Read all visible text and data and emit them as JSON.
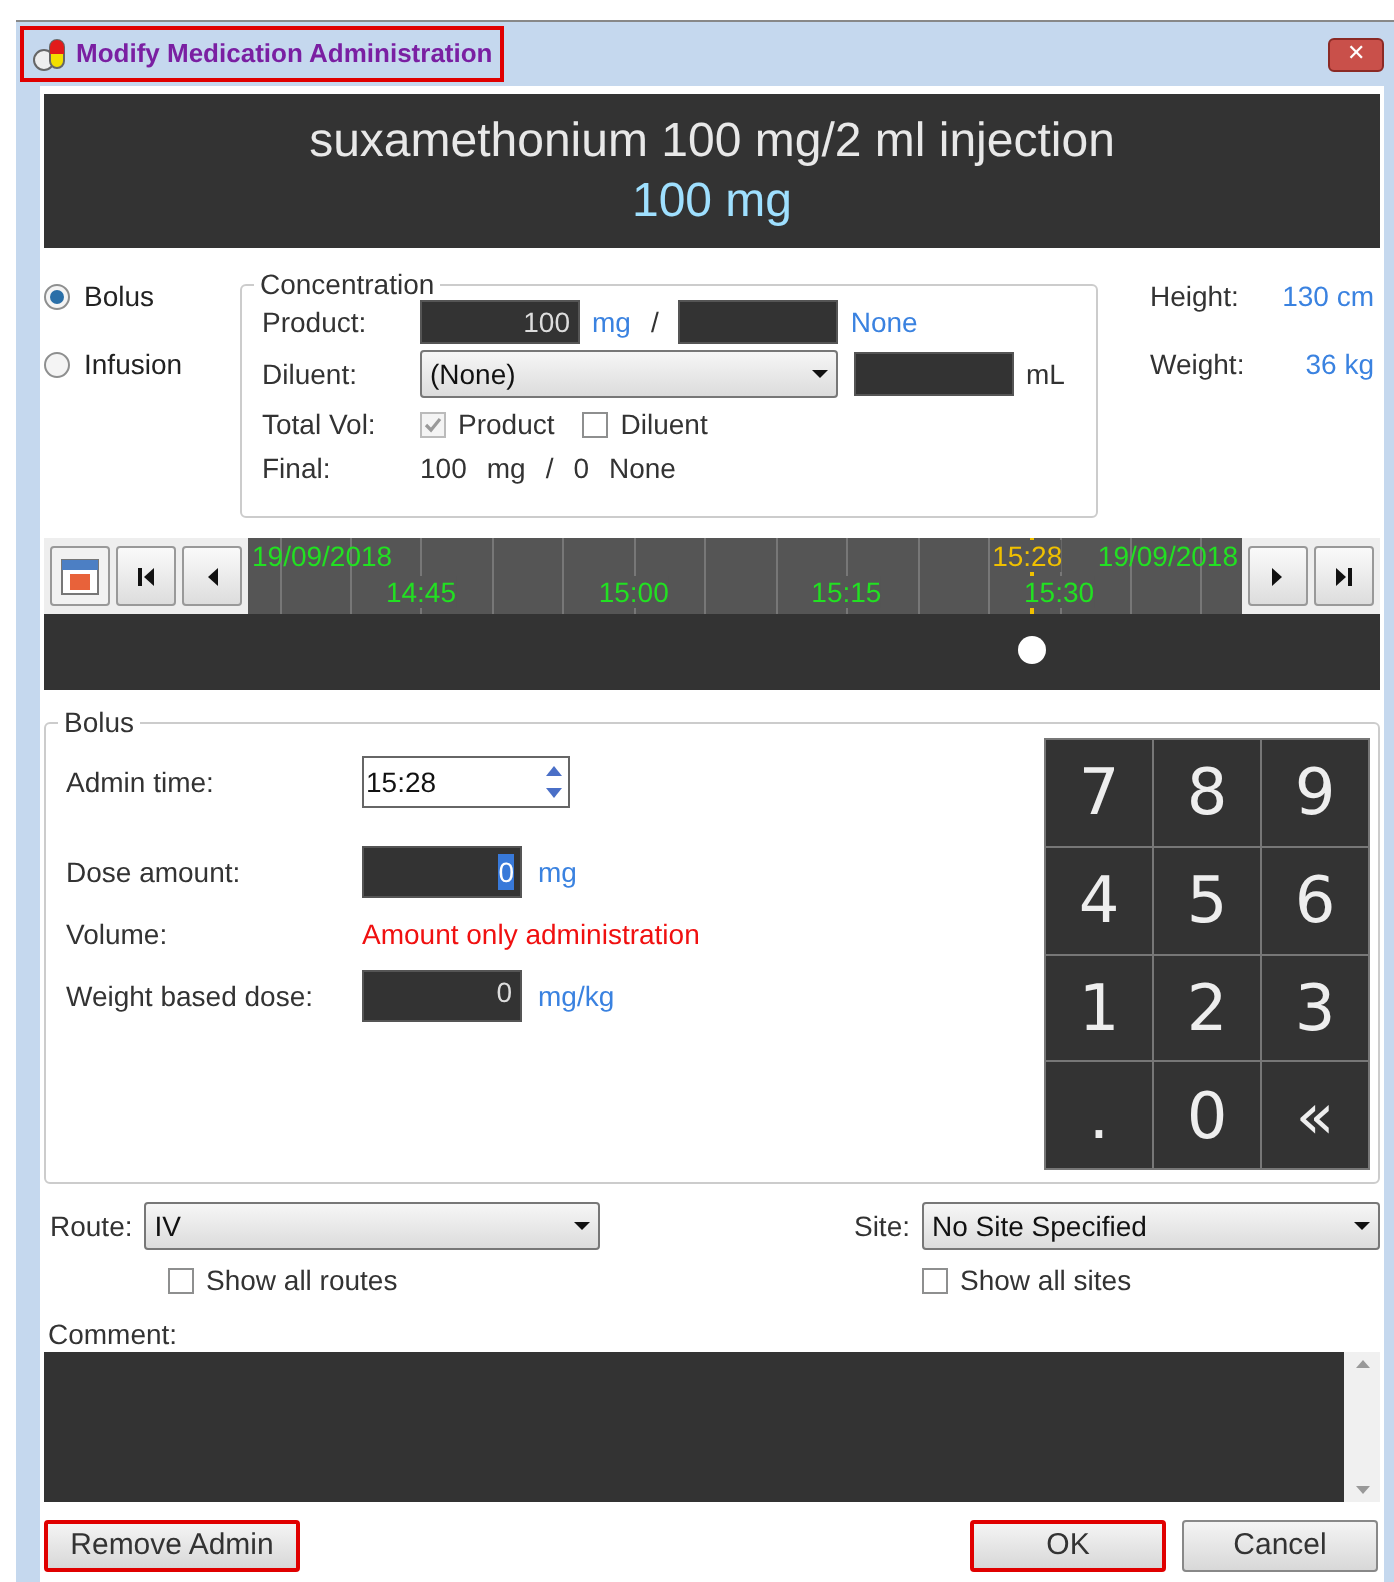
{
  "window": {
    "title": "Modify Medication Administration",
    "title_highlighted": true,
    "close": "✕"
  },
  "header": {
    "drug": "suxamethonium 100 mg/2 ml injection",
    "dose": "100 mg"
  },
  "mode_options": [
    {
      "label": "Bolus",
      "selected": true
    },
    {
      "label": "Infusion",
      "selected": false
    }
  ],
  "concentration": {
    "title": "Concentration",
    "product_label": "Product:",
    "product_value": "100",
    "product_unit": "mg",
    "slash": "/",
    "per_unit": "None",
    "diluent_label": "Diluent:",
    "diluent_value": "(None)",
    "diluent_unit": "mL",
    "total_vol_label": "Total Vol:",
    "total_vol_options": [
      {
        "label": "Product",
        "checked": true,
        "disabled": true
      },
      {
        "label": "Diluent",
        "checked": false,
        "disabled": false
      }
    ],
    "final_label": "Final:",
    "final_parts": [
      "100",
      "mg",
      "/",
      "0",
      "None"
    ]
  },
  "patient": [
    {
      "label": "Height:",
      "value": "130 cm"
    },
    {
      "label": "Weight:",
      "value": "36 kg"
    }
  ],
  "timeline": {
    "start_date": "19/09/2018",
    "end_date": "19/09/2018",
    "ticks": [
      "14:45",
      "15:00",
      "15:15",
      "15:30"
    ],
    "current": "15:28"
  },
  "bolus": {
    "title": "Bolus",
    "admin_time_label": "Admin time:",
    "admin_time": "15:28",
    "dose_label": "Dose amount:",
    "dose_value": "0",
    "dose_unit": "mg",
    "volume_label": "Volume:",
    "volume_value": "Amount only administration",
    "weight_label": "Weight based dose:",
    "weight_value": "0",
    "weight_unit": "mg/kg"
  },
  "keypad": [
    "7",
    "8",
    "9",
    "4",
    "5",
    "6",
    "1",
    "2",
    "3",
    ".",
    "0",
    "«"
  ],
  "route": {
    "label": "Route:",
    "value": "IV",
    "show_all_label": "Show all routes",
    "show_all_checked": false
  },
  "site": {
    "label": "Site:",
    "value": "No Site Specified",
    "show_all_label": "Show all sites",
    "show_all_checked": false
  },
  "comment": {
    "label": "Comment:"
  },
  "buttons": [
    {
      "label": "Remove Admin",
      "highlighted": true
    },
    {
      "label": "OK",
      "highlighted": true
    },
    {
      "label": "Cancel",
      "highlighted": false
    }
  ]
}
